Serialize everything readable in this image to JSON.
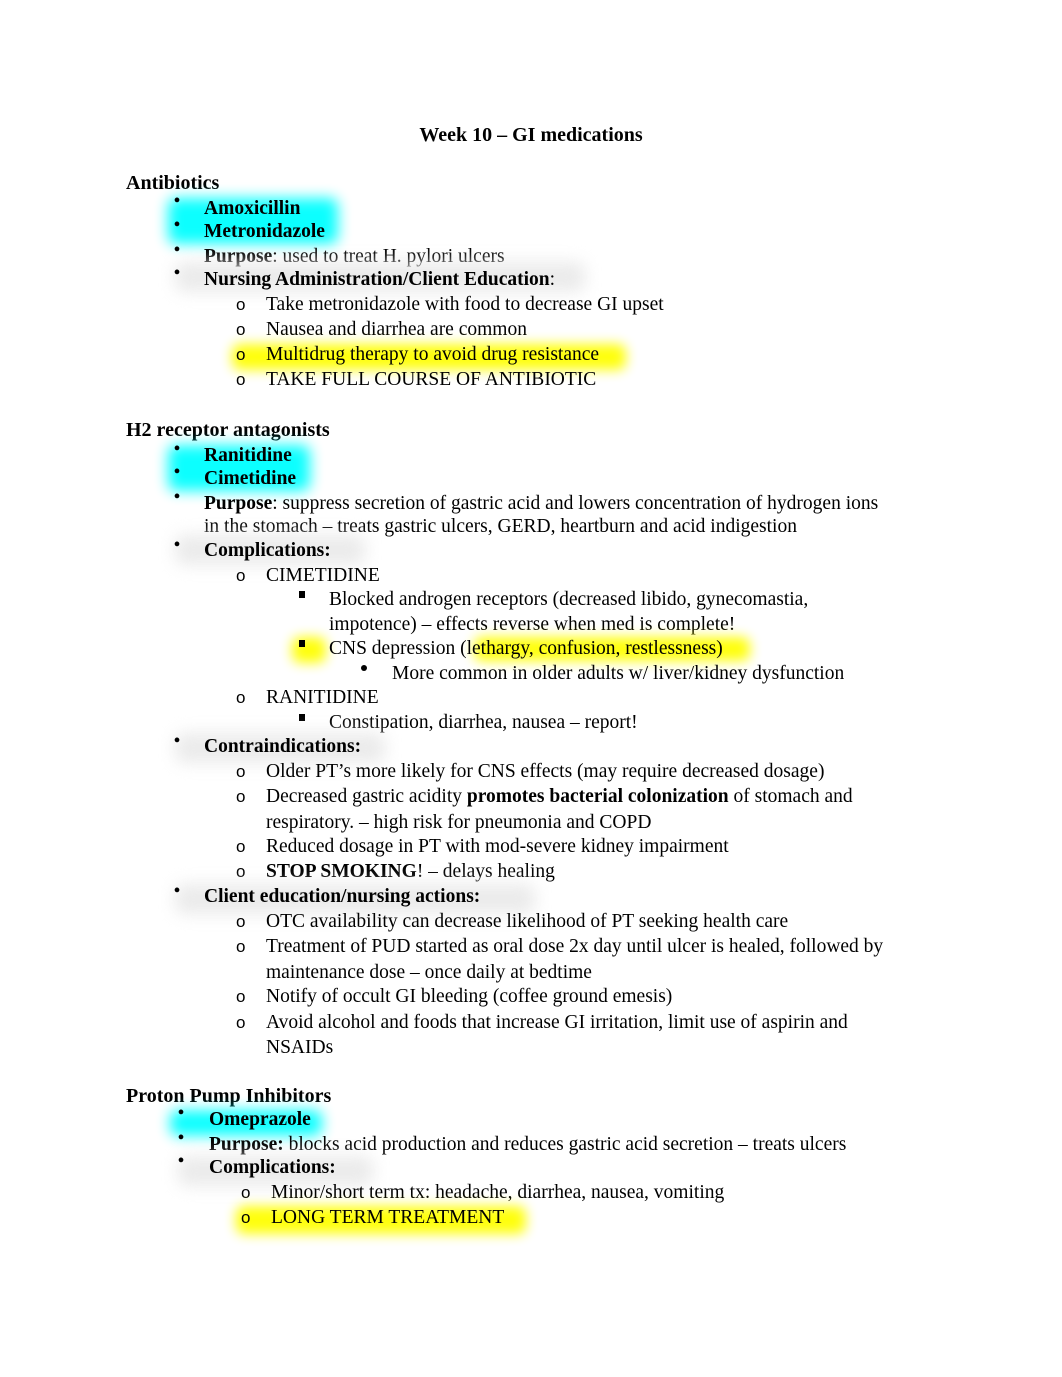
{
  "document": {
    "title": "Week 10 – GI medications",
    "colors": {
      "highlight_cyan": "#00FFFF",
      "highlight_yellow": "#FFFF00",
      "text": "#000000"
    },
    "sections": {
      "antibiotics": {
        "heading": "Antibiotics",
        "drugs": [
          "Amoxicillin",
          "Metronidazole"
        ],
        "purpose_label": "Purpose",
        "purpose_text": ": used to treat H. pylori ulcers",
        "nursing_label": "Nursing Administration/Client Education",
        "nursing_colon": ":",
        "nursing_items": [
          "Take metronidazole with food to decrease GI upset",
          "Nausea and diarrhea are common",
          "Multidrug therapy to avoid drug resistance",
          "TAKE FULL COURSE OF ANTIBIOTIC"
        ]
      },
      "h2": {
        "heading": "H2 receptor antagonists",
        "drugs": [
          "Ranitidine",
          "Cimetidine"
        ],
        "purpose_label": "Purpose",
        "purpose_line1": ": suppress secretion of gastric acid and lowers concentration of hydrogen ions",
        "purpose_line2": "in the stomach – treats gastric ulcers, GERD, heartburn and acid indigestion",
        "complications_label": "Complications:",
        "cimetidine_label": "CIMETIDINE",
        "cimetidine_item1_line1": "Blocked androgen receptors (decreased libido, gynecomastia,",
        "cimetidine_item1_line2": "impotence) – effects reverse when med is complete!",
        "cimetidine_item2_prefix": "CNS depression (",
        "cimetidine_item2_highlight": "lethargy, confusion, restlessness",
        "cimetidine_item2_suffix": ")",
        "cimetidine_item2_sub": "More common in older adults w/ liver/kidney dysfunction",
        "ranitidine_label": "RANITIDINE",
        "ranitidine_item": "Constipation, diarrhea, nausea – report!",
        "contraindications_label": "Contraindications:",
        "contra_items": {
          "older": "Older PT’s more likely for CNS effects (may require decreased dosage)",
          "acidity_prefix": "Decreased gastric acidity ",
          "acidity_bold": "promotes bacterial colonization",
          "acidity_suffix": " of stomach and",
          "acidity_line2": "respiratory. – high risk for pneumonia and COPD",
          "kidney": "Reduced dosage in PT with mod-severe kidney impairment",
          "smoking_bold": "STOP SMOKING",
          "smoking_rest": "! – delays healing"
        },
        "education_label": "Client education/nursing actions:",
        "education_items": {
          "otc": "OTC availability can decrease likelihood of PT seeking health care",
          "pud_line1": "Treatment of PUD started as oral dose 2x day until ulcer is healed, followed by",
          "pud_line2": "maintenance dose – once daily at bedtime",
          "bleeding": "Notify of occult GI bleeding (coffee ground emesis)",
          "avoid_line1": "Avoid alcohol and foods that increase GI irritation, limit use of aspirin and",
          "avoid_line2": "NSAIDs"
        }
      },
      "ppi": {
        "heading": "Proton Pump Inhibitors",
        "drugs": [
          "Omeprazole"
        ],
        "purpose_label": "Purpose:",
        "purpose_text": " blocks acid production and reduces gastric acid secretion – treats ulcers",
        "complications_label": "Complications:",
        "complication_items": [
          "Minor/short term tx: headache, diarrhea, nausea, vomiting",
          "LONG TERM TREATMENT"
        ]
      }
    }
  }
}
